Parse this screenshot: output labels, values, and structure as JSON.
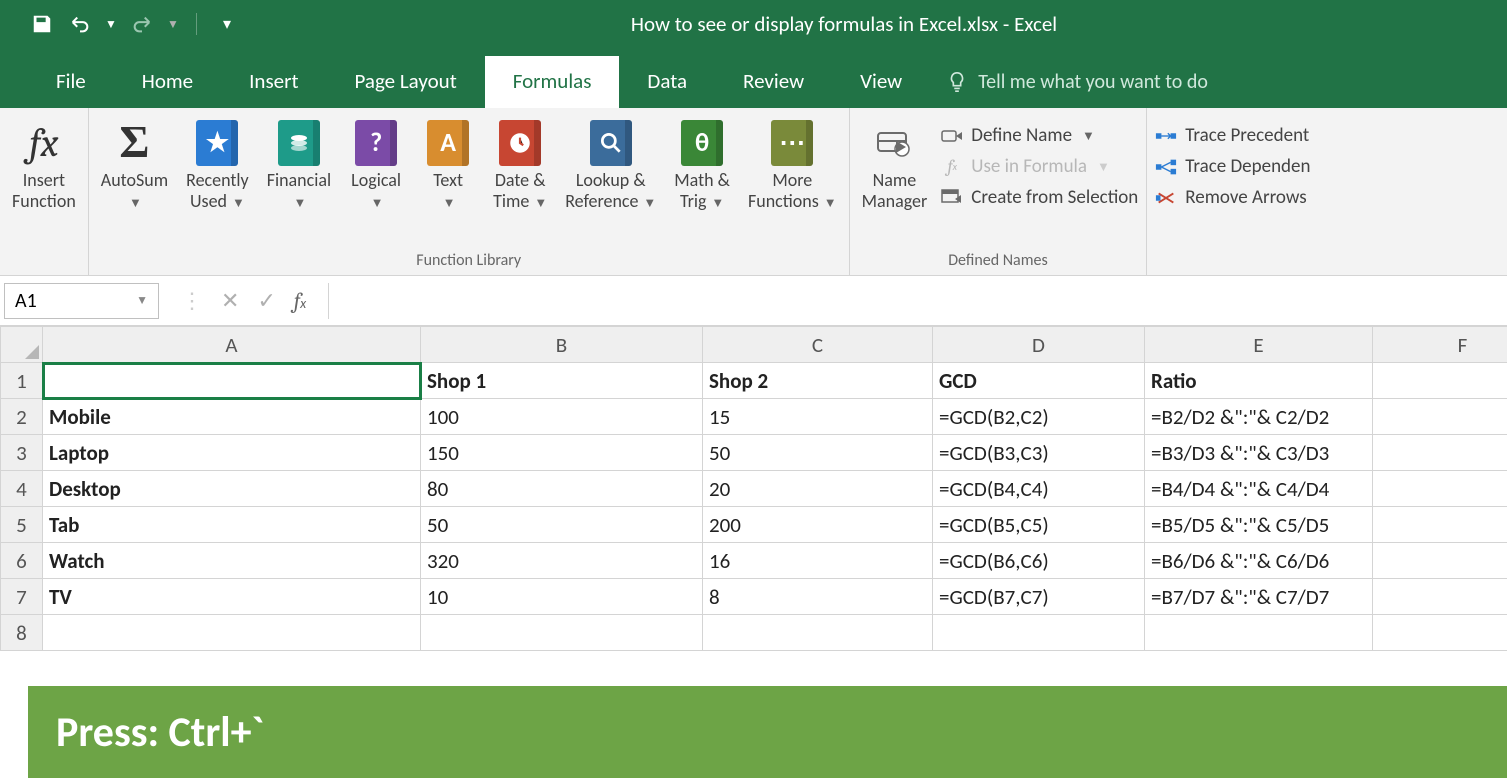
{
  "title_bar": {
    "document_title": "How to see or display formulas in Excel.xlsx - Excel"
  },
  "tabs": {
    "file": "File",
    "home": "Home",
    "insert": "Insert",
    "page_layout": "Page Layout",
    "formulas": "Formulas",
    "data": "Data",
    "review": "Review",
    "view": "View",
    "tell_me": "Tell me what you want to do"
  },
  "ribbon": {
    "insert_function": "Insert\nFunction",
    "autosum": "AutoSum",
    "recently_used": "Recently\nUsed",
    "financial": "Financial",
    "logical": "Logical",
    "text": "Text",
    "date_time": "Date &\nTime",
    "lookup_ref": "Lookup &\nReference",
    "math_trig": "Math &\nTrig",
    "more_functions": "More\nFunctions",
    "group_function_library": "Function Library",
    "name_manager": "Name\nManager",
    "define_name": "Define Name",
    "use_in_formula": "Use in Formula",
    "create_from_selection": "Create from Selection",
    "group_defined_names": "Defined Names",
    "trace_precedents": "Trace Precedent",
    "trace_dependents": "Trace Dependen",
    "remove_arrows": "Remove Arrows"
  },
  "name_box": "A1",
  "columns": [
    "A",
    "B",
    "C",
    "D",
    "E",
    "F"
  ],
  "rows": [
    {
      "n": "1",
      "A": "",
      "B": "Shop 1",
      "C": "Shop 2",
      "D": "GCD",
      "E": "Ratio",
      "F": ""
    },
    {
      "n": "2",
      "A": "Mobile",
      "B": "100",
      "C": "15",
      "D": "=GCD(B2,C2)",
      "E": "=B2/D2 &\":\"& C2/D2",
      "F": ""
    },
    {
      "n": "3",
      "A": "Laptop",
      "B": "150",
      "C": "50",
      "D": "=GCD(B3,C3)",
      "E": "=B3/D3 &\":\"& C3/D3",
      "F": ""
    },
    {
      "n": "4",
      "A": "Desktop",
      "B": "80",
      "C": "20",
      "D": "=GCD(B4,C4)",
      "E": "=B4/D4 &\":\"& C4/D4",
      "F": ""
    },
    {
      "n": "5",
      "A": "Tab",
      "B": "50",
      "C": "200",
      "D": "=GCD(B5,C5)",
      "E": "=B5/D5 &\":\"& C5/D5",
      "F": ""
    },
    {
      "n": "6",
      "A": "Watch",
      "B": "320",
      "C": "16",
      "D": "=GCD(B6,C6)",
      "E": "=B6/D6 &\":\"& C6/D6",
      "F": ""
    },
    {
      "n": "7",
      "A": "TV",
      "B": "10",
      "C": "8",
      "D": "=GCD(B7,C7)",
      "E": "=B7/D7 &\":\"& C7/D7",
      "F": ""
    },
    {
      "n": "8",
      "A": "",
      "B": "",
      "C": "",
      "D": "",
      "E": "",
      "F": ""
    }
  ],
  "hint": "Press: Ctrl+`"
}
